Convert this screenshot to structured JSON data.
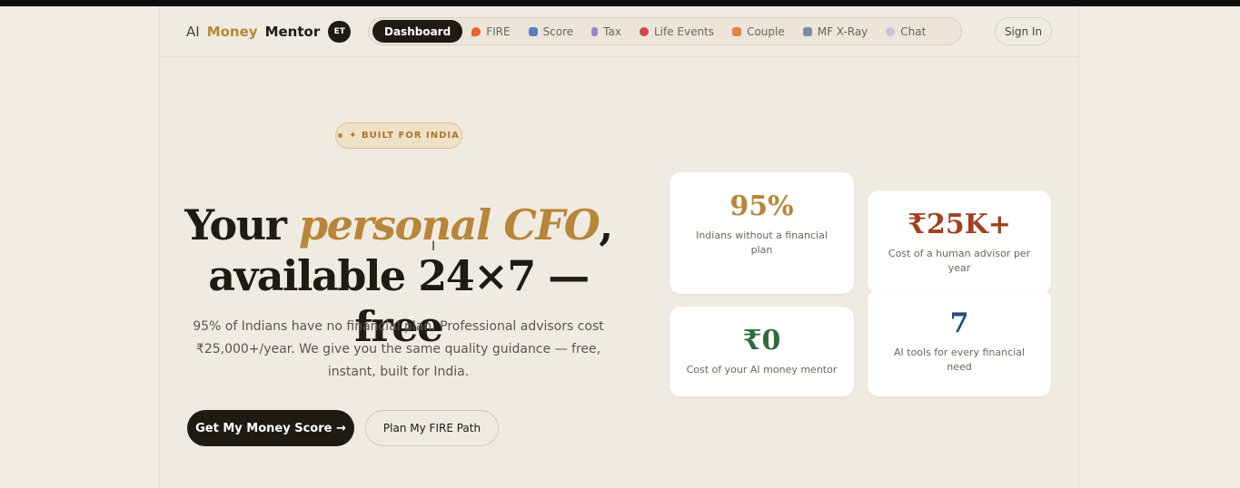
{
  "brand": {
    "ai": "AI",
    "money": "Money",
    "mentor": "Mentor",
    "badge": "ET"
  },
  "nav": {
    "items": [
      {
        "label": "Dashboard",
        "icon": "dashboard",
        "active": true
      },
      {
        "label": "FIRE",
        "icon": "fire-icon",
        "color": "#e8642a"
      },
      {
        "label": "Score",
        "icon": "chart-icon",
        "color": "#5a7fc0"
      },
      {
        "label": "Tax",
        "icon": "receipt-icon",
        "color": "#9a86c9"
      },
      {
        "label": "Life Events",
        "icon": "target-icon",
        "color": "#d1474f"
      },
      {
        "label": "Couple",
        "icon": "couple-icon",
        "color": "#e6833c"
      },
      {
        "label": "MF X-Ray",
        "icon": "microscope-icon",
        "color": "#7b8aa8"
      },
      {
        "label": "Chat",
        "icon": "speech-bubble-icon",
        "color": "#c9c3d8"
      }
    ]
  },
  "signin": "Sign In",
  "hero": {
    "badge": "✦ BUILT FOR INDIA",
    "headline_1": "Your ",
    "headline_accent": "personal CFO",
    "headline_2": ",",
    "headline_3": "available 24×7 — free",
    "subtext": "95% of Indians have no financial plan. Professional advisors cost ₹25,000+/year. We give you the same quality guidance — free, instant, built for India.",
    "cta_primary": "Get My Money Score →",
    "cta_secondary": "Plan My FIRE Path"
  },
  "stats": [
    {
      "value": "95%",
      "label": "Indians without a financial plan",
      "color": "#b7863a"
    },
    {
      "value": "₹25K+",
      "label": "Cost of a human advisor per year",
      "color": "#a1401f"
    },
    {
      "value": "₹0",
      "label": "Cost of your AI money mentor",
      "color": "#2f6b3f"
    },
    {
      "value": "7",
      "label": "AI tools for every financial need",
      "color": "#1f4f7f"
    }
  ]
}
